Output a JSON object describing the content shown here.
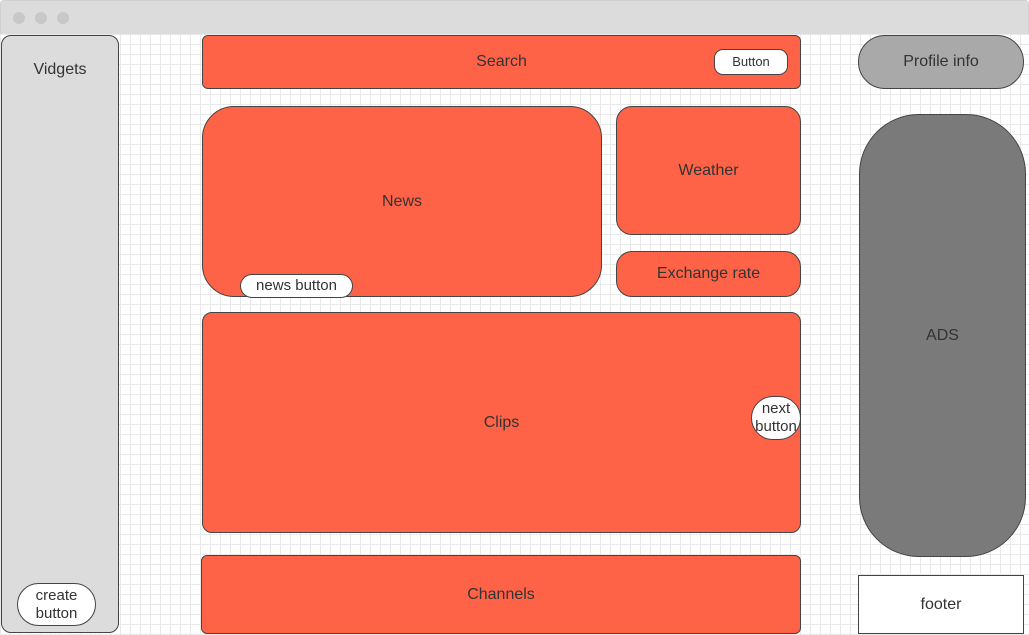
{
  "window": {
    "controls": [
      "close",
      "minimize",
      "maximize"
    ]
  },
  "sidebar": {
    "title": "Vidgets",
    "create_button": "create button"
  },
  "search": {
    "label": "Search",
    "button": "Button"
  },
  "profile": {
    "label": "Profile info"
  },
  "news": {
    "label": "News",
    "button": "news button"
  },
  "weather": {
    "label": "Weather"
  },
  "exchange": {
    "label": "Exchange rate"
  },
  "clips": {
    "label": "Clips",
    "next_button": "next button"
  },
  "ads": {
    "label": "ADS"
  },
  "channels": {
    "label": "Channels"
  },
  "footer": {
    "label": "footer"
  },
  "colors": {
    "accent": "#ff6347",
    "sidebar": "#dcdcdc",
    "profile": "#a9a9a9",
    "ads": "#7a7a7a"
  }
}
